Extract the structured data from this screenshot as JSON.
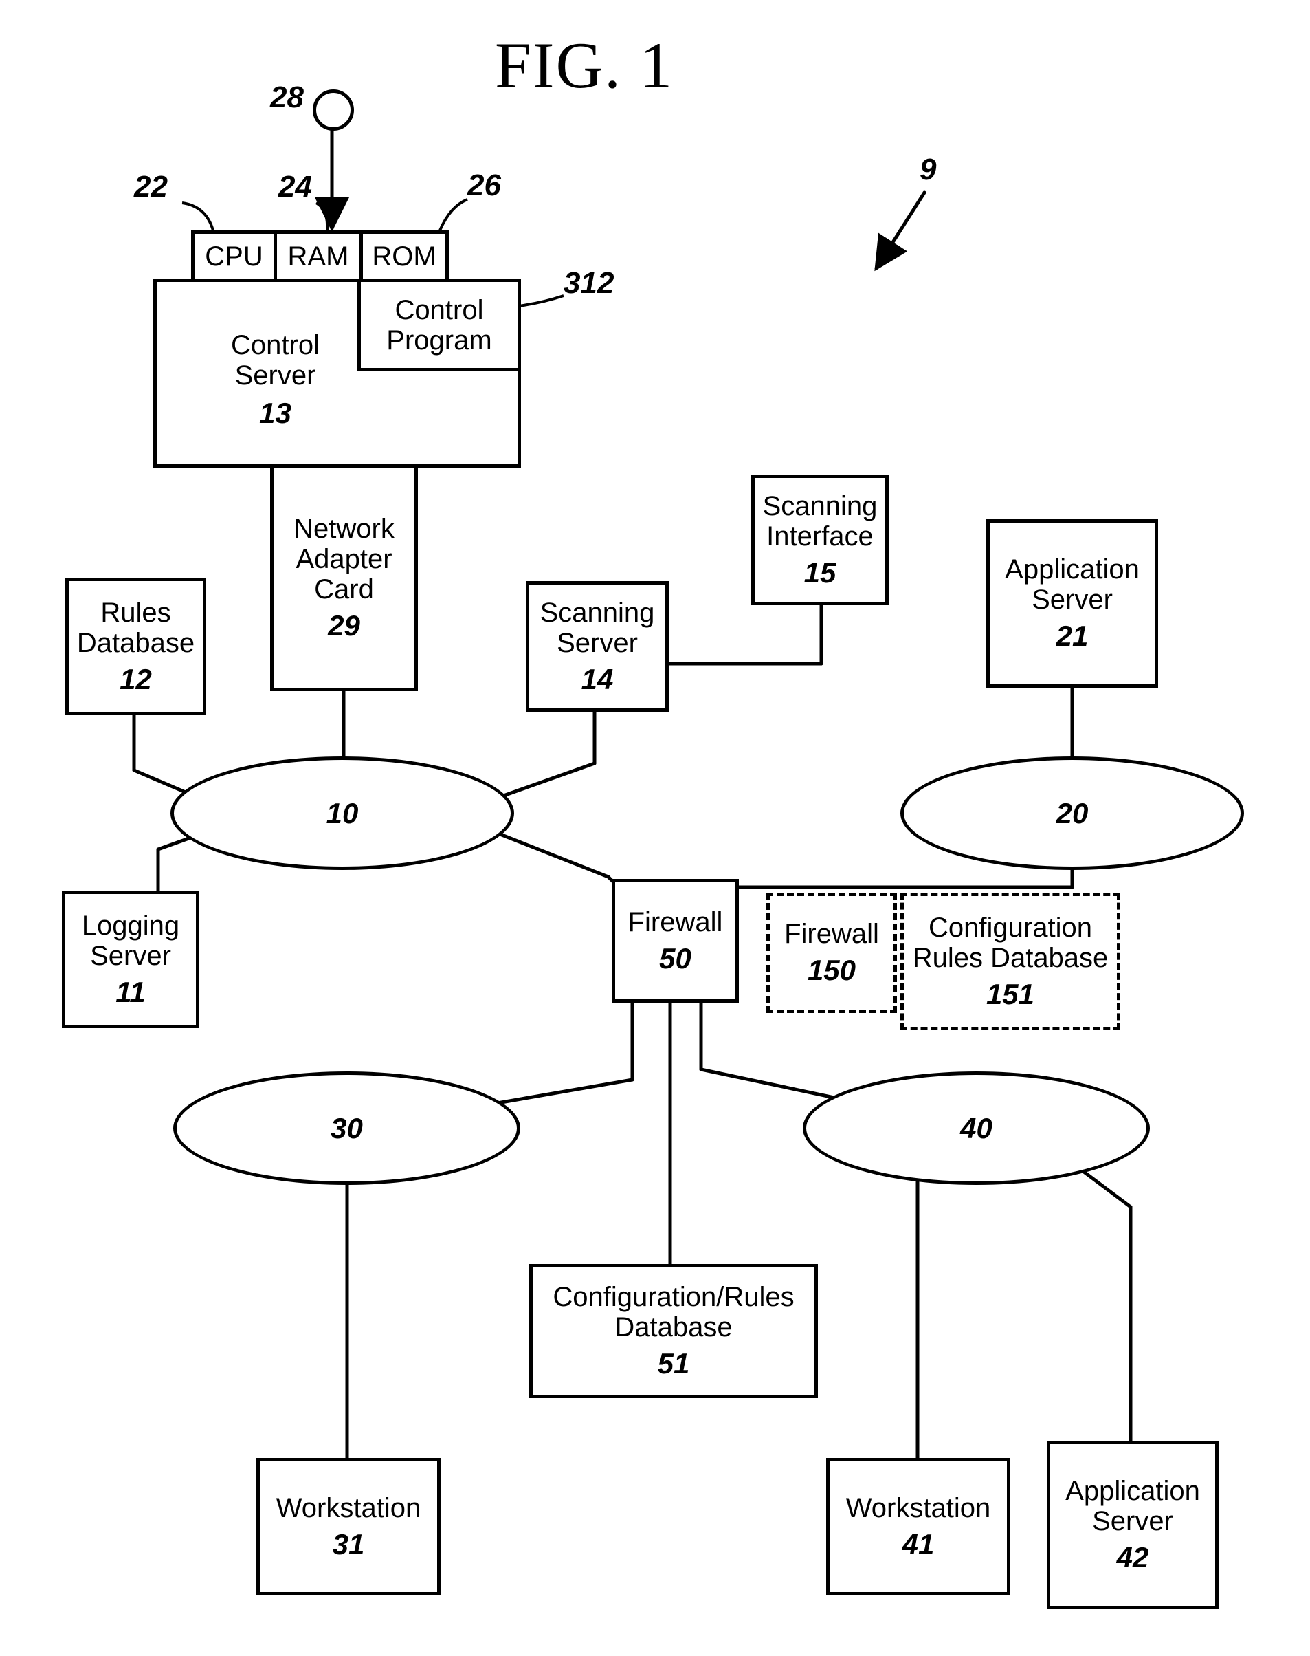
{
  "figure": {
    "title": "FIG. 1"
  },
  "labels": {
    "n9": "9",
    "n28": "28",
    "n24": "24",
    "n22": "22",
    "n26": "26",
    "n312": "312"
  },
  "boxes": {
    "cpu": {
      "label": "CPU"
    },
    "ram": {
      "label": "RAM"
    },
    "rom": {
      "label": "ROM"
    },
    "controlProgram": {
      "label": "Control\nProgram"
    },
    "controlServer": {
      "label": "Control\nServer",
      "num": "13"
    },
    "nac": {
      "label": "Network\nAdapter\nCard",
      "num": "29"
    },
    "rulesDb": {
      "label": "Rules\nDatabase",
      "num": "12"
    },
    "scanningServer": {
      "label": "Scanning\nServer",
      "num": "14"
    },
    "scanningInterface": {
      "label": "Scanning\nInterface",
      "num": "15"
    },
    "appServer21": {
      "label": "Application\nServer",
      "num": "21"
    },
    "loggingServer": {
      "label": "Logging\nServer",
      "num": "11"
    },
    "firewall50": {
      "label": "Firewall",
      "num": "50"
    },
    "firewall150": {
      "label": "Firewall",
      "num": "150"
    },
    "configRules151": {
      "label": "Configuration\nRules Database",
      "num": "151"
    },
    "configRules51": {
      "label": "Configuration/Rules\nDatabase",
      "num": "51"
    },
    "workstation31": {
      "label": "Workstation",
      "num": "31"
    },
    "workstation41": {
      "label": "Workstation",
      "num": "41"
    },
    "appServer42": {
      "label": "Application\nServer",
      "num": "42"
    }
  },
  "ellipses": {
    "e10": {
      "num": "10"
    },
    "e20": {
      "num": "20"
    },
    "e30": {
      "num": "30"
    },
    "e40": {
      "num": "40"
    }
  }
}
